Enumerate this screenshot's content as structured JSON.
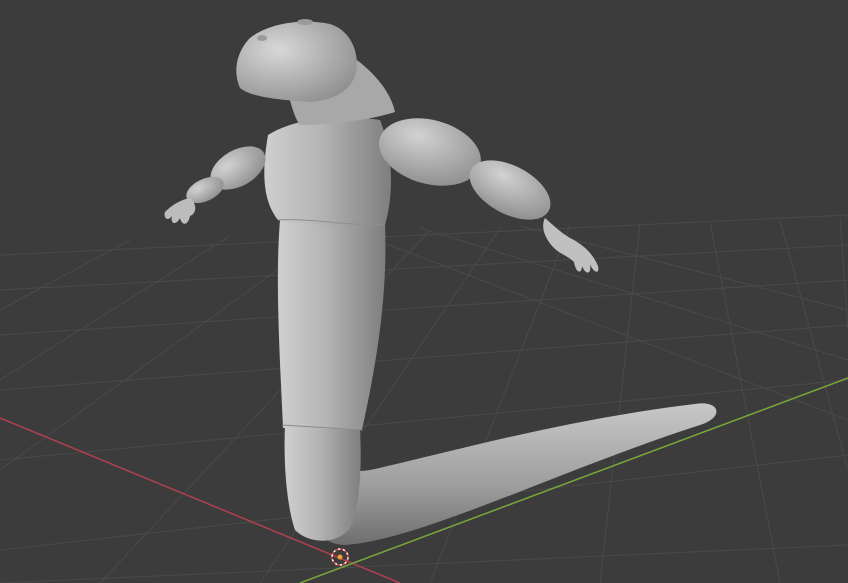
{
  "viewport": {
    "background": "#3c3c3c",
    "grid_color": "#4a4a4a",
    "x_axis_color": "#b04050",
    "y_axis_color": "#7aa63a",
    "model_color": "#b0b0b0",
    "origin_icon": "3d-cursor-icon"
  }
}
